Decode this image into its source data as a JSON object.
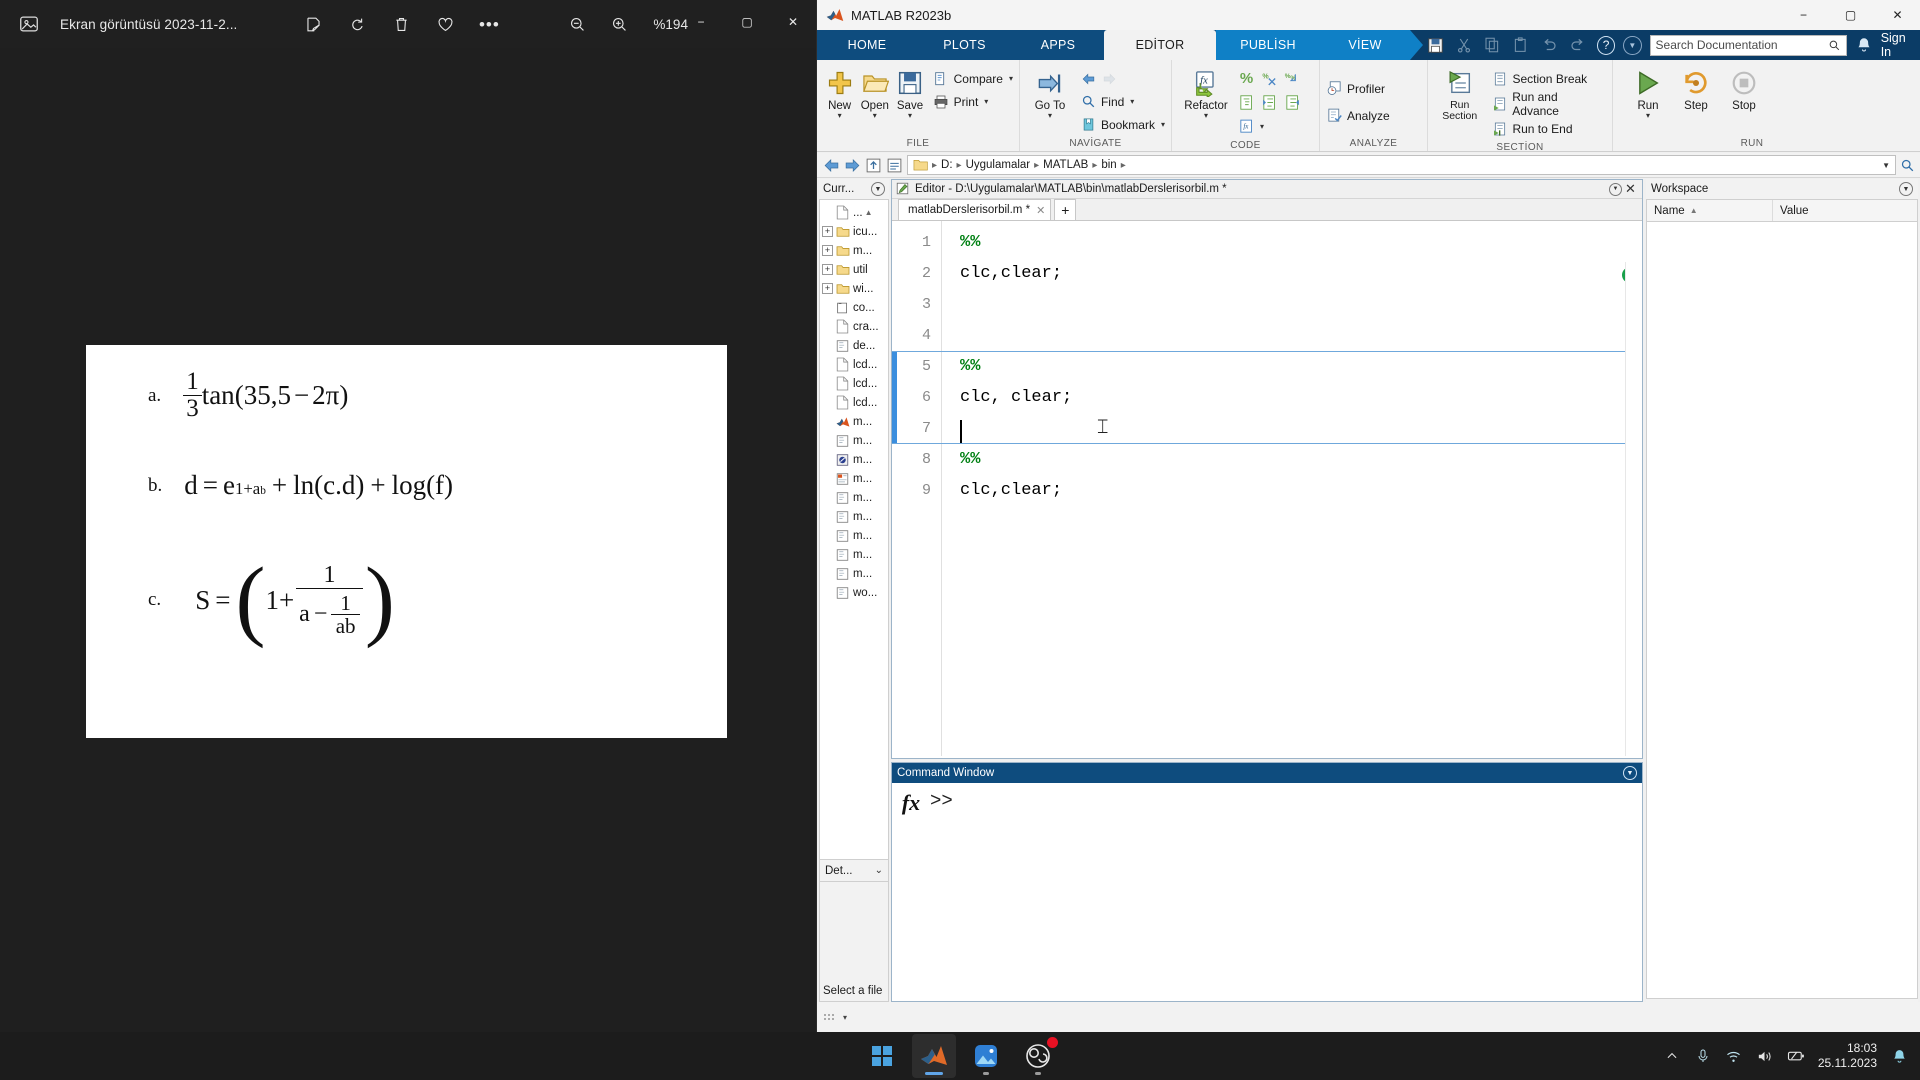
{
  "photos": {
    "app_icon": "photos-icon",
    "title": "Ekran görüntüsü 2023-11-2...",
    "tools": [
      {
        "name": "edit-image-icon",
        "glyph": "✎"
      },
      {
        "name": "rotate-icon",
        "glyph": "↻"
      },
      {
        "name": "delete-icon",
        "glyph": "🗑"
      },
      {
        "name": "favorite-icon",
        "glyph": "♡"
      },
      {
        "name": "more-options-icon",
        "glyph": "•••"
      }
    ],
    "zoom_out_icon": "zoom-out-icon",
    "zoom_in_icon": "zoom-in-icon",
    "zoom_level": "%194",
    "window_controls": {
      "minimize": "−",
      "maximize": "▢",
      "close": "✕"
    },
    "image_content": {
      "items": [
        {
          "label": "a.",
          "formula": "(1/3)·tan(35,5 − 2π)"
        },
        {
          "label": "b.",
          "formula": "d = e^(1+a^b) + ln(c.d) + log(f)"
        },
        {
          "label": "c.",
          "formula": "S = (1 + 1/(a − 1/ab))"
        }
      ],
      "a": {
        "label": "a.",
        "num": "1",
        "den": "3",
        "tan": "tan",
        "open": "(",
        "arg": "35,5",
        "minus": "−",
        "twopi": "2π",
        "close": ")"
      },
      "b": {
        "label": "b.",
        "lhs": "d",
        "eq": "=",
        "e": "e",
        "exp1": "1+a",
        "exp2": "b",
        "plus1": "+",
        "ln": "ln(c.d)",
        "plus2": "+",
        "log": "log(f)"
      },
      "c": {
        "label": "c.",
        "lhs": "S",
        "eq": "=",
        "one_plus": "1+",
        "num": "1",
        "den_a": "a",
        "den_minus": "−",
        "inner_num": "1",
        "inner_den": "ab"
      }
    }
  },
  "matlab": {
    "window_title": "MATLAB R2023b",
    "logo_icon": "matlab-logo-icon",
    "window_controls": {
      "minimize": "−",
      "maximize": "▢",
      "close": "✕"
    },
    "tabs": [
      {
        "id": "home",
        "label": "HOME",
        "active": false
      },
      {
        "id": "plots",
        "label": "PLOTS",
        "active": false
      },
      {
        "id": "apps",
        "label": "APPS",
        "active": false
      },
      {
        "id": "editor",
        "label": "EDİTOR",
        "active": true
      },
      {
        "id": "publish",
        "label": "PUBLİSH",
        "active": false
      },
      {
        "id": "view",
        "label": "VİEW",
        "active": false
      }
    ],
    "quick_access": [
      {
        "name": "save-icon",
        "enabled": true
      },
      {
        "name": "cut-icon",
        "enabled": false
      },
      {
        "name": "copy-icon",
        "enabled": false
      },
      {
        "name": "paste-icon",
        "enabled": false
      },
      {
        "name": "undo-icon",
        "enabled": false
      },
      {
        "name": "redo-icon",
        "enabled": false
      }
    ],
    "help_icon": "help-question-icon",
    "help_dropdown_icon": "help-dropdown-icon",
    "search": {
      "placeholder": "Search Documentation",
      "value": "",
      "icon": "search-icon"
    },
    "notification_icon": "bell-icon",
    "sign_in_label": "Sign In",
    "ribbon": {
      "groups": [
        {
          "name": "FILE",
          "big_buttons": [
            {
              "label": "New",
              "icon": "new-file-icon",
              "has_dropdown": true
            },
            {
              "label": "Open",
              "icon": "open-folder-icon",
              "has_dropdown": true
            },
            {
              "label": "Save",
              "icon": "save-disk-icon",
              "has_dropdown": true
            }
          ],
          "small_buttons": [
            {
              "label": "Compare",
              "icon": "compare-icon",
              "has_dropdown": true
            },
            {
              "label": "Print",
              "icon": "print-icon",
              "has_dropdown": true
            }
          ]
        },
        {
          "name": "NAVİGATE",
          "big_buttons": [
            {
              "label": "Go To",
              "icon": "goto-icon",
              "has_dropdown": true
            }
          ],
          "small_buttons": [
            {
              "label": "",
              "icon": "nav-back-icon",
              "has_dropdown": false
            },
            {
              "label": "Find",
              "icon": "find-icon",
              "has_dropdown": true
            },
            {
              "label": "Bookmark",
              "icon": "bookmark-icon",
              "has_dropdown": true
            }
          ]
        },
        {
          "name": "CODE",
          "big_buttons": [
            {
              "label": "Refactor",
              "icon": "refactor-fx-icon",
              "has_dropdown": true
            }
          ],
          "small_buttons": [
            {
              "label": "",
              "icon": "comment-percent-icon",
              "has_dropdown": false
            },
            {
              "label": "",
              "icon": "uncomment-icon",
              "has_dropdown": false
            },
            {
              "label": "",
              "icon": "wrap-comment-icon",
              "has_dropdown": false
            },
            {
              "label": "",
              "icon": "smart-indent-icon",
              "has_dropdown": false
            },
            {
              "label": "",
              "icon": "indent-right-icon",
              "has_dropdown": false
            },
            {
              "label": "",
              "icon": "indent-left-icon",
              "has_dropdown": false
            },
            {
              "label": "",
              "icon": "function-hint-icon",
              "has_dropdown": true
            }
          ]
        },
        {
          "name": "ANALYZE",
          "big_buttons": [],
          "small_buttons": [
            {
              "label": "Profiler",
              "icon": "profiler-icon",
              "has_dropdown": false
            },
            {
              "label": "Analyze",
              "icon": "analyze-icon",
              "has_dropdown": false
            }
          ]
        },
        {
          "name": "SECTİON",
          "big_buttons": [
            {
              "label": "Run Section",
              "icon": "run-section-icon",
              "has_dropdown": false
            }
          ],
          "small_buttons": [
            {
              "label": "Section Break",
              "icon": "section-break-icon",
              "has_dropdown": false
            },
            {
              "label": "Run and Advance",
              "icon": "run-advance-icon",
              "has_dropdown": false
            },
            {
              "label": "Run to End",
              "icon": "run-to-end-icon",
              "has_dropdown": false
            }
          ]
        },
        {
          "name": "RUN",
          "big_buttons": [
            {
              "label": "Run",
              "icon": "run-icon",
              "has_dropdown": true
            },
            {
              "label": "Step",
              "icon": "step-icon",
              "has_dropdown": false
            },
            {
              "label": "Stop",
              "icon": "stop-icon",
              "has_dropdown": false
            }
          ],
          "small_buttons": []
        }
      ]
    },
    "pathbar": {
      "back_icon": "back-arrow-icon",
      "forward_icon": "forward-arrow-icon",
      "up_icon": "up-folder-icon",
      "browse_icon": "browse-folder-icon",
      "folder_icon": "folder-icon",
      "crumbs": [
        "D:",
        "Uygulamalar",
        "MATLAB",
        "bin"
      ],
      "dropdown_icon": "chevron-down-icon",
      "search_icon": "search-path-icon"
    },
    "current_folder": {
      "title": "Curr...",
      "dropdown_icon": "panel-options-icon",
      "items": [
        {
          "name": "...",
          "icon": "file-icon",
          "expandable": false,
          "up": true
        },
        {
          "name": "icu...",
          "icon": "folder-icon",
          "expandable": true
        },
        {
          "name": "m...",
          "icon": "folder-icon",
          "expandable": true
        },
        {
          "name": "util",
          "icon": "folder-icon",
          "expandable": true
        },
        {
          "name": "wi...",
          "icon": "folder-icon",
          "expandable": true
        },
        {
          "name": "co...",
          "icon": "config-file-icon",
          "expandable": false
        },
        {
          "name": "cra...",
          "icon": "file-icon",
          "expandable": false
        },
        {
          "name": "de...",
          "icon": "script-file-icon",
          "expandable": false
        },
        {
          "name": "lcd...",
          "icon": "file-icon",
          "expandable": false
        },
        {
          "name": "lcd...",
          "icon": "file-icon",
          "expandable": false
        },
        {
          "name": "lcd...",
          "icon": "file-icon",
          "expandable": false
        },
        {
          "name": "m...",
          "icon": "matlab-file-icon",
          "expandable": false
        },
        {
          "name": "m...",
          "icon": "script-file-icon",
          "expandable": false
        },
        {
          "name": "m...",
          "icon": "mlapp-file-icon",
          "expandable": false
        },
        {
          "name": "m...",
          "icon": "live-script-icon",
          "expandable": false
        },
        {
          "name": "m...",
          "icon": "script-file-icon",
          "expandable": false
        },
        {
          "name": "m...",
          "icon": "script-file-icon",
          "expandable": false
        },
        {
          "name": "m...",
          "icon": "script-file-icon",
          "expandable": false
        },
        {
          "name": "m...",
          "icon": "script-file-icon",
          "expandable": false
        },
        {
          "name": "m...",
          "icon": "script-file-icon",
          "expandable": false
        },
        {
          "name": "wo...",
          "icon": "script-file-icon",
          "expandable": false
        }
      ],
      "details_label": "Det...",
      "details_chevron": "chevron-down-icon",
      "preview_text": "Select a file"
    },
    "editor": {
      "panel_title": "Editor - D:\\Uygulamalar\\MATLAB\\bin\\matlabDerslerisorbil.m *",
      "panel_icon": "editor-doc-icon",
      "minimize_icon": "panel-options-icon",
      "close_icon": "close-icon",
      "tab": {
        "label": "matlabDerslerisorbil.m *",
        "close_icon": "close-icon"
      },
      "new_tab_icon": "plus-icon",
      "status_icon": "checkmark-ok-icon",
      "lines": [
        {
          "n": "1",
          "text": "%%",
          "type": "comment"
        },
        {
          "n": "2",
          "text": "clc,clear;",
          "type": "code"
        },
        {
          "n": "3",
          "text": "",
          "type": "code"
        },
        {
          "n": "4",
          "text": "",
          "type": "code"
        },
        {
          "n": "5",
          "text": "%%",
          "type": "comment"
        },
        {
          "n": "6",
          "text": "clc, clear;",
          "type": "code"
        },
        {
          "n": "7",
          "text": "",
          "type": "code"
        },
        {
          "n": "8",
          "text": "%%",
          "type": "comment"
        },
        {
          "n": "9",
          "text": "clc,clear;",
          "type": "code"
        }
      ],
      "active_section_lines": [
        5,
        6,
        7
      ]
    },
    "command_window": {
      "title": "Command Window",
      "dropdown_icon": "panel-options-icon",
      "fx_label": "fx",
      "prompt": ">>"
    },
    "workspace": {
      "title": "Workspace",
      "dropdown_icon": "panel-options-icon",
      "columns": [
        "Name",
        "Value"
      ],
      "sort_icon": "sort-ascending-icon",
      "rows": []
    }
  },
  "taskbar": {
    "items": [
      {
        "name": "start-button",
        "icon": "windows-logo-icon",
        "active": false,
        "running": false
      },
      {
        "name": "taskbar-matlab",
        "icon": "matlab-logo-icon",
        "active": true,
        "running": true
      },
      {
        "name": "taskbar-photos",
        "icon": "photos-app-icon",
        "active": false,
        "running": true
      },
      {
        "name": "taskbar-obs",
        "icon": "obs-studio-icon",
        "active": false,
        "running": true,
        "badge": true
      }
    ],
    "tray": [
      {
        "name": "show-hidden-icons",
        "glyph": "︿"
      },
      {
        "name": "microphone-icon",
        "glyph": "🎙"
      },
      {
        "name": "wifi-icon",
        "glyph": "wifi"
      },
      {
        "name": "volume-icon",
        "glyph": "🔊"
      },
      {
        "name": "battery-icon",
        "glyph": "battery"
      }
    ],
    "clock": {
      "time": "18:03",
      "date": "25.11.2023"
    },
    "notification_icon": "bell-icon"
  }
}
